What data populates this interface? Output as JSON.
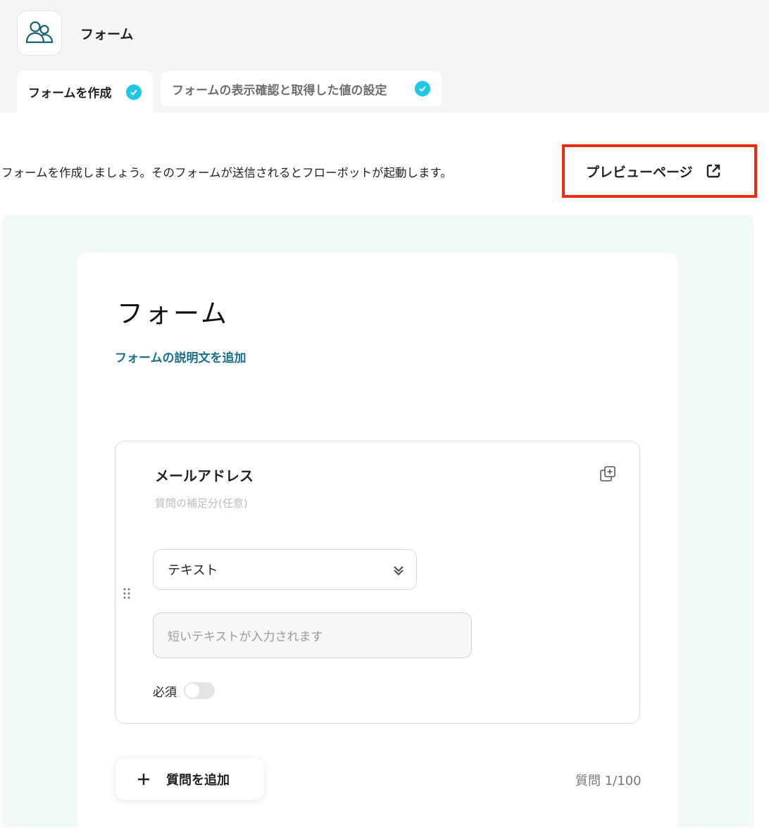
{
  "header": {
    "app_icon": "users-icon",
    "app_title": "フォーム"
  },
  "tabs": [
    {
      "label": "フォームを作成",
      "status": "check-icon"
    },
    {
      "label": "フォームの表示確認と取得した値の設定",
      "status": "check-icon"
    }
  ],
  "intro_text": "フォームを作成しましょう。そのフォームが送信されるとフローボットが起動します。",
  "preview_button": {
    "label": "プレビューページ",
    "icon": "external-link-icon"
  },
  "form": {
    "title": "フォーム",
    "description_link": "フォームの説明文を追加",
    "questions": [
      {
        "title": "メールアドレス",
        "subtitle_placeholder": "質問の補足分(任意)",
        "type": "テキスト",
        "answer_placeholder": "短いテキストが入力されます",
        "required_label": "必須",
        "required": false
      }
    ],
    "add_question_label": "質問を追加",
    "question_count": "質問 1/100"
  },
  "colors": {
    "accent": "#1ec7e3",
    "link": "#1a6f88",
    "highlight_border": "#ee2b10",
    "canvas": "#f2faf9"
  }
}
